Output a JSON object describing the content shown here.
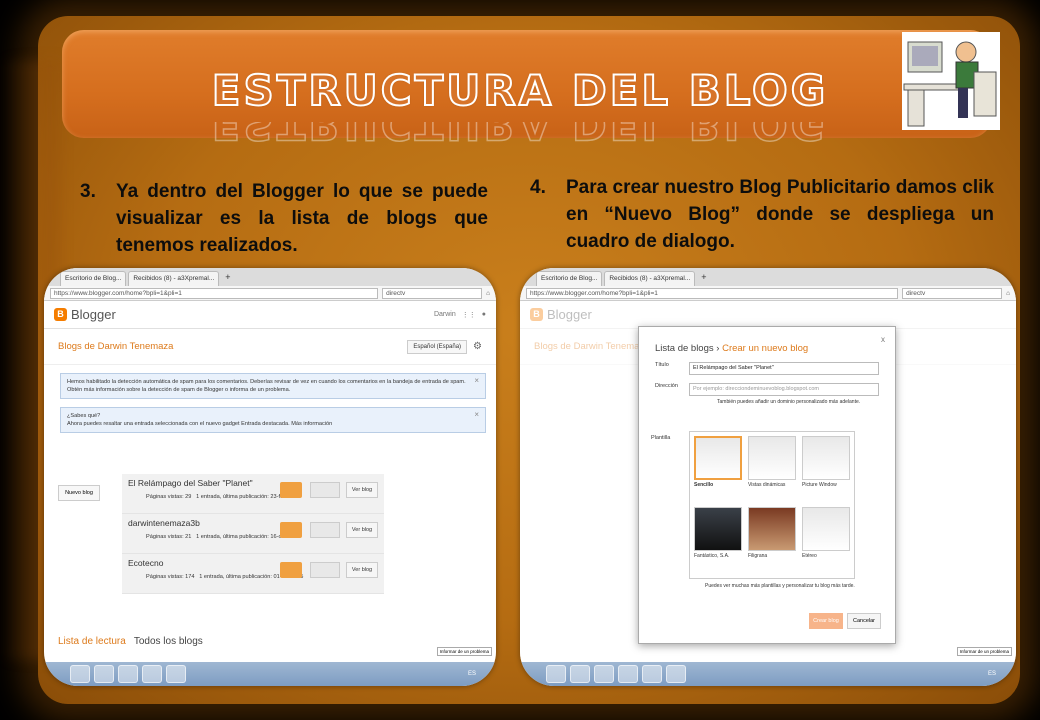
{
  "slide_title": "ESTRUCTURA DEL BLOG",
  "step3": {
    "num": "3.",
    "text": "Ya dentro del Blogger  lo que se puede visualizar es la lista de blogs que tenemos realizados."
  },
  "step4": {
    "num": "4.",
    "text": "Para crear nuestro Blog Publicitario damos clik en “Nuevo Blog” donde se despliega un cuadro de dialogo."
  },
  "browser": {
    "tabs": [
      "Escritorio de Blog...",
      "Recibidos (8) - a3Xpremal...",
      "+"
    ],
    "url": "https://www.blogger.com/home?bpli=1&pli=1",
    "search": "directv"
  },
  "blogger": {
    "logo": "Blogger",
    "user": "Darwin",
    "blogs_title": "Blogs de Darwin Tenemaza",
    "language": "Español (España)",
    "notice1": "Hemos habilitado la detección automática de spam para los comentarios. Deberías revisar de vez en cuando los comentarios en la bandeja de entrada de spam. Obtén más información sobre la detección de spam de Blogger o informa de un problema.",
    "notice2_title": "¿Sabes qué?",
    "notice2": "Ahora puedes resaltar una entrada seleccionada con el nuevo gadget Entrada destacada. Más información",
    "new_blog": "Nuevo blog",
    "view": "Ver blog",
    "blogs": [
      {
        "name": "El Relámpago del Saber \"Planet\"",
        "views": "Páginas vistas: 29",
        "info": "1 entrada, última publicación: 23-feb-2016"
      },
      {
        "name": "darwintenemaza3b",
        "views": "Páginas vistas: 21",
        "info": "1 entrada, última publicación: 16-oct-2015"
      },
      {
        "name": "Ecotecno",
        "views": "Páginas vistas: 174",
        "info": "1 entrada, última publicación: 01-oct-2015"
      }
    ],
    "reading_list": "Lista de lectura",
    "all_blogs": "Todos los blogs",
    "tooltip": "Informar de un problema"
  },
  "dialog": {
    "crumb": "Lista de blogs",
    "title": "Crear un nuevo blog",
    "close": "x",
    "title_label": "Título",
    "title_value": "El Relámpago del Saber \"Planet\"",
    "address_label": "Dirección",
    "address_placeholder": "Por ejemplo: direcciondeminuevoblog.blogspot.com",
    "hint": "También puedes añadir un dominio personalizado más adelante.",
    "template_label": "Plantilla",
    "templates": [
      "Sencillo",
      "Vistas dinámicas",
      "Picture Window",
      "Fantástico, S.A.",
      "Filigrana",
      "Etéreo"
    ],
    "more": "Puedes ver muchas más plantillas y personalizar tu blog más tarde.",
    "create": "Crear blog",
    "cancel": "Cancelar"
  },
  "tray_lang": "ES"
}
